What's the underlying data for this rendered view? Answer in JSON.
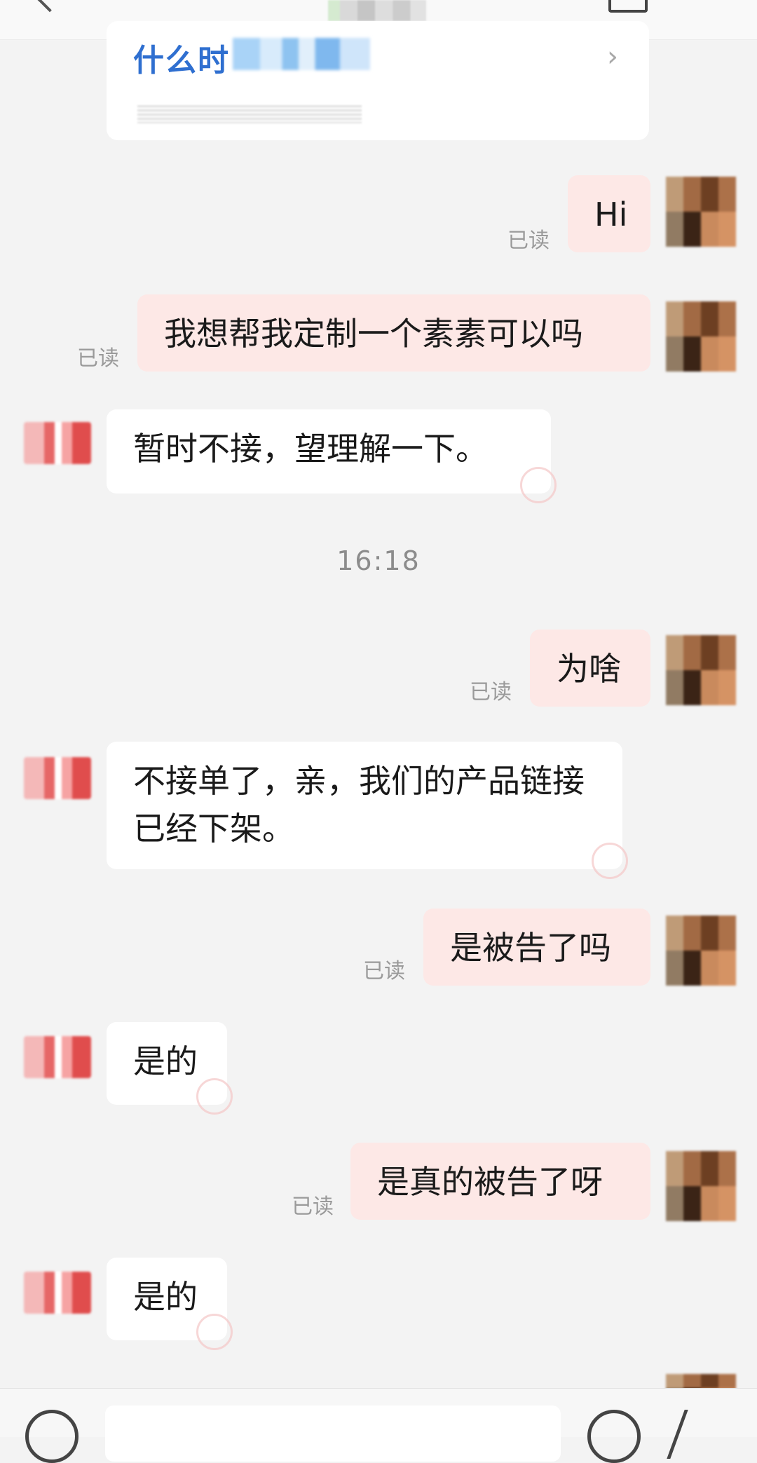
{
  "header": {
    "back_icon": "chevron-left-icon",
    "menu_icon": "menu-icon"
  },
  "card": {
    "title_prefix": "什么时"
  },
  "messages": [
    {
      "from": "me",
      "text": "Hi",
      "status": "已读"
    },
    {
      "from": "me",
      "text": "我想帮我定制一个素素可以吗",
      "status": "已读"
    },
    {
      "from": "them",
      "text": "暂时不接，望理解一下。"
    },
    {
      "type": "time",
      "text": "16:18"
    },
    {
      "from": "me",
      "text": "为啥",
      "status": "已读"
    },
    {
      "from": "them",
      "text": "不接单了，亲，我们的产品链接已经下架。"
    },
    {
      "from": "me",
      "text": "是被告了吗",
      "status": "已读"
    },
    {
      "from": "them",
      "text": "是的"
    },
    {
      "from": "me",
      "text": "是真的被告了呀",
      "status": "已读"
    },
    {
      "from": "them",
      "text": "是的"
    }
  ],
  "colors": {
    "background": "#f3f3f3",
    "my_bubble": "#fde8e6",
    "their_bubble": "#ffffff",
    "link_blue": "#2f6fd0",
    "read_text": "#9a9a9a"
  },
  "bottom_bar": {
    "voice_icon": "voice-icon",
    "emoji_icon": "emoji-icon",
    "plus_icon": "plus-icon"
  }
}
